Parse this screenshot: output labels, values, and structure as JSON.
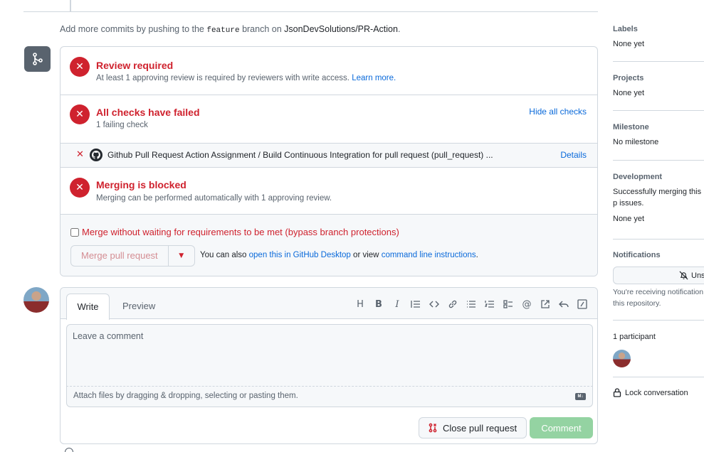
{
  "hint": {
    "prefix": "Add more commits by pushing to the",
    "branch": "feature",
    "middle": "branch on",
    "repo": "JsonDevSolutions/PR-Action",
    "suffix": "."
  },
  "merge_box": {
    "review": {
      "title": "Review required",
      "subtitle": "At least 1 approving review is required by reviewers with write access.",
      "learn_more": "Learn more."
    },
    "checks": {
      "title": "All checks have failed",
      "subtitle": "1 failing check",
      "hide_link": "Hide all checks"
    },
    "check_item": {
      "name": "Github Pull Request Action Assignment / Build Continuous Integration for pull request (pull_request) ...",
      "details": "Details"
    },
    "blocked": {
      "title": "Merging is blocked",
      "subtitle": "Merging can be performed automatically with 1 approving review."
    },
    "bypass_label": "Merge without waiting for requirements to be met (bypass branch protections)",
    "merge_button": "Merge pull request",
    "also_prefix": "You can also",
    "desktop_link": "open this in GitHub Desktop",
    "also_middle": "or view",
    "cli_link": "command line instructions",
    "also_suffix": "."
  },
  "comment": {
    "tab_write": "Write",
    "tab_preview": "Preview",
    "toolbar": [
      "heading-icon",
      "bold-icon",
      "italic-icon",
      "quote-icon",
      "code-icon",
      "link-icon",
      "unordered-list-icon",
      "ordered-list-icon",
      "task-list-icon",
      "mention-icon",
      "reference-icon",
      "reply-icon",
      "slash-command-icon"
    ],
    "placeholder": "Leave a comment",
    "attach_hint": "Attach files by dragging & dropping, selecting or pasting them.",
    "md_badge": "M↓",
    "close_button": "Close pull request",
    "comment_button": "Comment"
  },
  "sidebar": {
    "labels": {
      "title": "Labels",
      "value": "None yet"
    },
    "projects": {
      "title": "Projects",
      "value": "None yet"
    },
    "milestone": {
      "title": "Milestone",
      "value": "No milestone"
    },
    "development": {
      "title": "Development",
      "text": "Successfully merging this p issues.",
      "value": "None yet"
    },
    "notifications": {
      "title": "Notifications",
      "button": "Uns",
      "text": "You're receiving notification this repository."
    },
    "participants": {
      "title": "1 participant"
    },
    "lock": "Lock conversation"
  },
  "colors": {
    "danger": "#cf222e",
    "link": "#0969da",
    "muted": "#59636e",
    "border": "#d0d7de",
    "success_disabled": "#94d3a2"
  }
}
